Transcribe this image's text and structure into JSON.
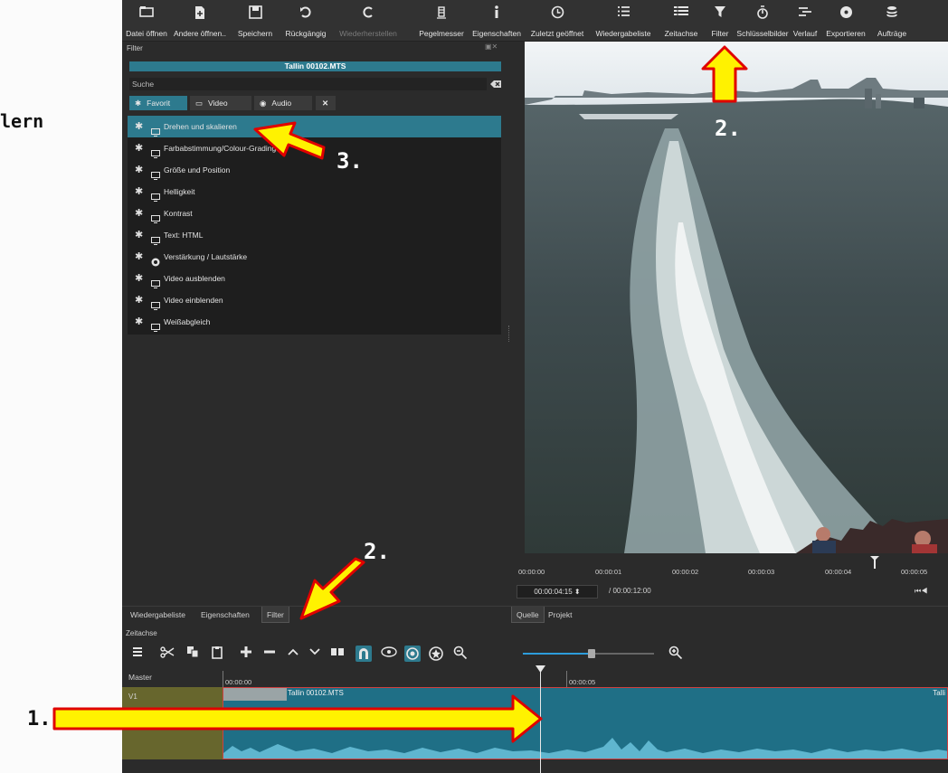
{
  "margin_text": "lern",
  "toolbar": {
    "items": [
      {
        "label": "Datei öffnen",
        "icon": "folder-open-icon",
        "disabled": false
      },
      {
        "label": "Andere öffnen..",
        "icon": "file-plus-icon",
        "disabled": false
      },
      {
        "label": "Speichern",
        "icon": "floppy-disk-icon",
        "disabled": false
      },
      {
        "label": "Rückgängig",
        "icon": "undo-icon",
        "disabled": false
      },
      {
        "label": "Wiederherstellen",
        "icon": "redo-icon",
        "disabled": true
      },
      {
        "label": "Pegelmesser",
        "icon": "level-meter-icon",
        "disabled": false
      },
      {
        "label": "Eigenschaften",
        "icon": "info-icon",
        "disabled": false
      },
      {
        "label": "Zuletzt geöffnet",
        "icon": "clock-icon",
        "disabled": false
      },
      {
        "label": "Wiedergabeliste",
        "icon": "list-icon",
        "disabled": false
      },
      {
        "label": "Zeitachse",
        "icon": "timeline-icon",
        "disabled": false
      },
      {
        "label": "Filter",
        "icon": "funnel-icon",
        "disabled": false
      },
      {
        "label": "Schlüsselbilder",
        "icon": "stopwatch-icon",
        "disabled": false
      },
      {
        "label": "Verlauf",
        "icon": "history-icon",
        "disabled": false
      },
      {
        "label": "Exportieren",
        "icon": "export-disc-icon",
        "disabled": false
      },
      {
        "label": "Aufträge",
        "icon": "jobs-stack-icon",
        "disabled": false
      }
    ]
  },
  "filter_panel": {
    "title": "Filter",
    "clip_name": "Tallin 00102.MTS",
    "search_placeholder": "Suche",
    "tabs": {
      "favorite": "Favorit",
      "video": "Video",
      "audio": "Audio"
    },
    "items": [
      {
        "label": "Drehen und skalieren",
        "type": "video",
        "selected": true
      },
      {
        "label": "Farbabstimmung/Colour-Grading",
        "type": "video",
        "selected": false
      },
      {
        "label": "Größe und Position",
        "type": "video",
        "selected": false
      },
      {
        "label": "Helligkeit",
        "type": "video",
        "selected": false
      },
      {
        "label": "Kontrast",
        "type": "video",
        "selected": false
      },
      {
        "label": "Text: HTML",
        "type": "video",
        "selected": false
      },
      {
        "label": "Verstärkung / Lautstärke",
        "type": "audio",
        "selected": false
      },
      {
        "label": "Video ausblenden",
        "type": "video",
        "selected": false
      },
      {
        "label": "Video einblenden",
        "type": "video",
        "selected": false
      },
      {
        "label": "Weißabgleich",
        "type": "video",
        "selected": false
      }
    ]
  },
  "left_tabs": [
    "Wiedergabeliste",
    "Eigenschaften",
    "Filter"
  ],
  "viewer": {
    "ruler_ticks": [
      "00:00:00",
      "00:00:01",
      "00:00:02",
      "00:00:03",
      "00:00:04",
      "00:00:05"
    ],
    "timecode": "00:00:04:15",
    "total": "/ 00:00:12:00"
  },
  "right_tabs": [
    "Quelle",
    "Projekt"
  ],
  "timeline": {
    "title": "Zeitachse",
    "master_label": "Master",
    "track_name": "V1",
    "ticks": [
      "00:00:00",
      "00:00:05"
    ],
    "clip_name": "Tallin 00102.MTS",
    "clip_name_right": "Talli"
  },
  "annotations": {
    "step1": "1.",
    "step2_top": "2.",
    "step2_bottom": "2.",
    "step3": "3."
  }
}
